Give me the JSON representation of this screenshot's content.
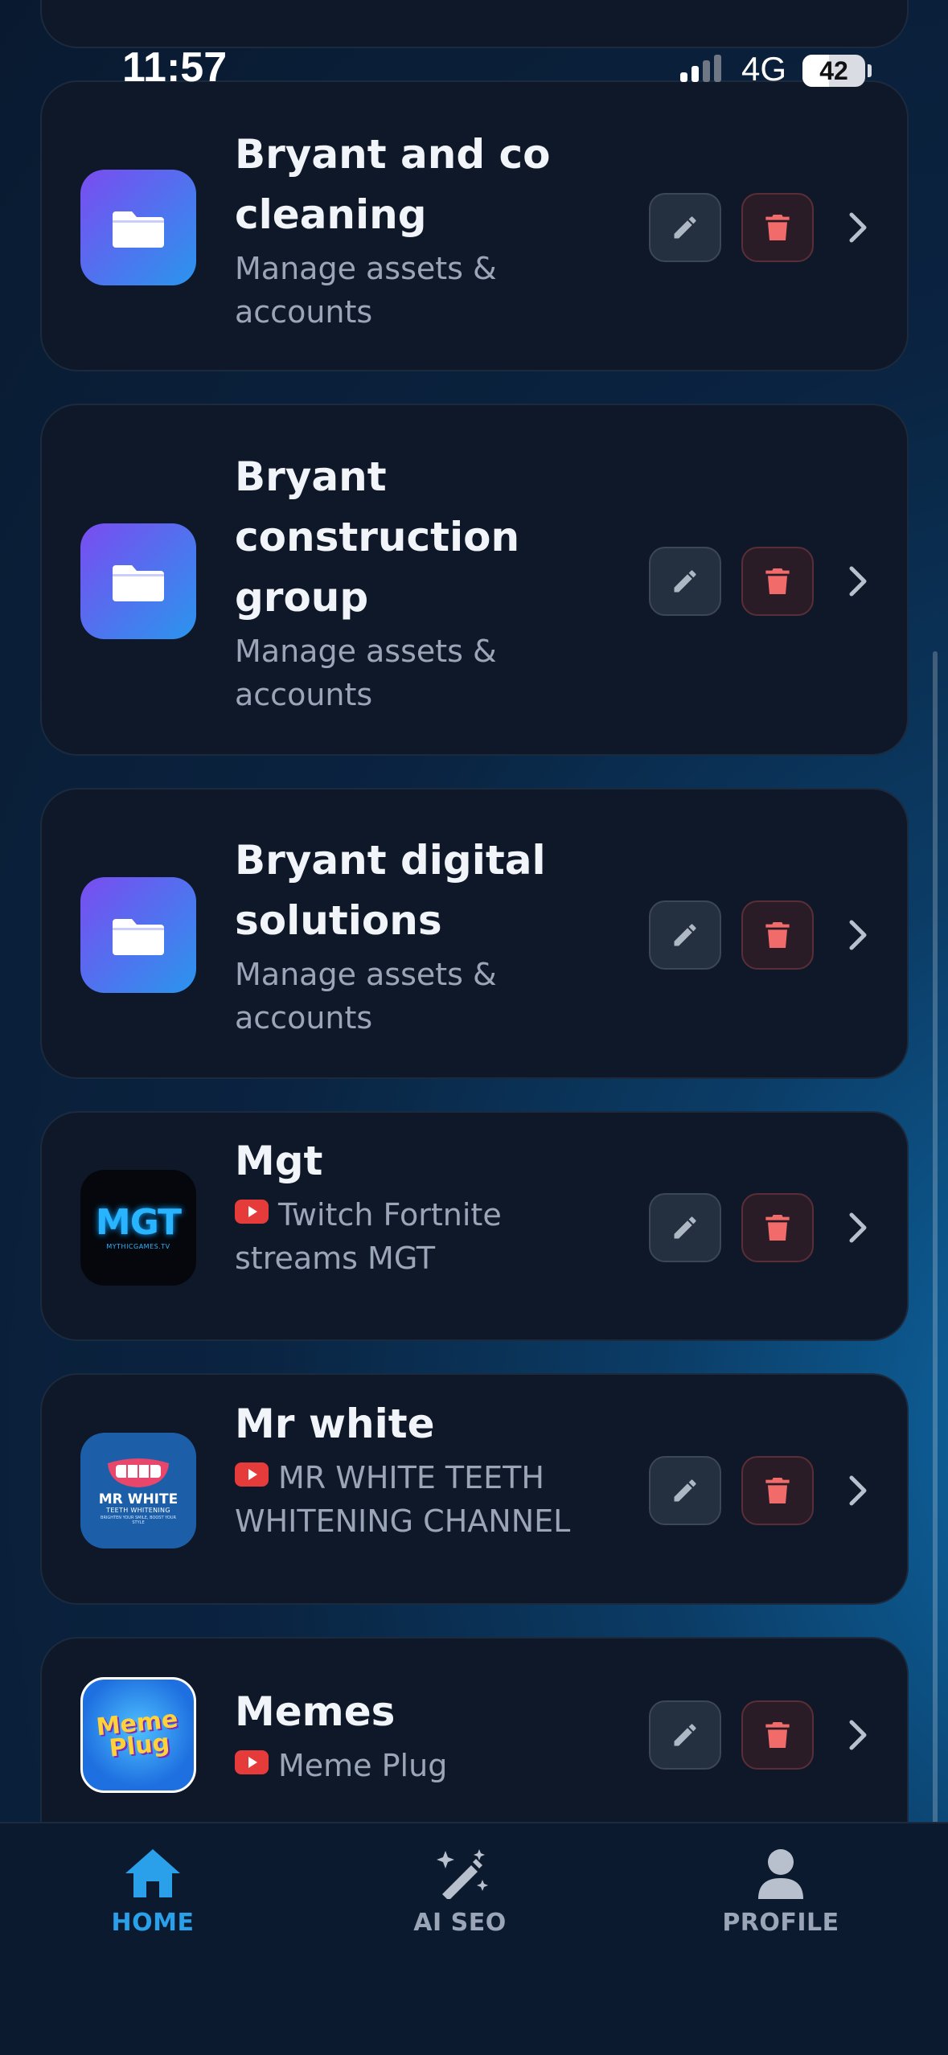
{
  "status_bar": {
    "time": "11:57",
    "network": "4G",
    "battery": "42"
  },
  "items": [
    {
      "title": "Bryant and co cleaning",
      "subtitle": "Manage assets & accounts",
      "avatar": "folder-icon"
    },
    {
      "title": "Bryant construction group",
      "subtitle": "Manage assets & accounts",
      "avatar": "folder-icon"
    },
    {
      "title": "Bryant digital solutions",
      "subtitle": "Manage assets & accounts",
      "avatar": "folder-icon"
    },
    {
      "title": "Mgt",
      "subtitle": "Twitch Fortnite streams MGT",
      "avatar": "mgt-logo",
      "logo_text": "MGT",
      "logo_sub": "MYTHICGAMES.TV"
    },
    {
      "title": "Mr white",
      "subtitle": "MR WHITE TEETH WHITENING CHANNEL",
      "avatar": "mr-white-logo",
      "logo_text": "MR WHITE",
      "logo_sub": "TEETH WHITENING",
      "logo_sub2": "BRIGHTEN YOUR SMILE, BOOST YOUR STYLE"
    },
    {
      "title": "Memes",
      "subtitle": "Meme Plug",
      "avatar": "meme-plug-logo",
      "logo_text": "Meme Plug"
    }
  ],
  "tabs": [
    {
      "label": "HOME",
      "icon": "home-icon",
      "active": true
    },
    {
      "label": "AI SEO",
      "icon": "magic-wand-icon",
      "active": false
    },
    {
      "label": "PROFILE",
      "icon": "user-icon",
      "active": false
    }
  ],
  "colors": {
    "accent": "#2aa0ea",
    "card": "#0f1828",
    "delete": "#f26b6b",
    "youtube": "#e53b3b"
  }
}
